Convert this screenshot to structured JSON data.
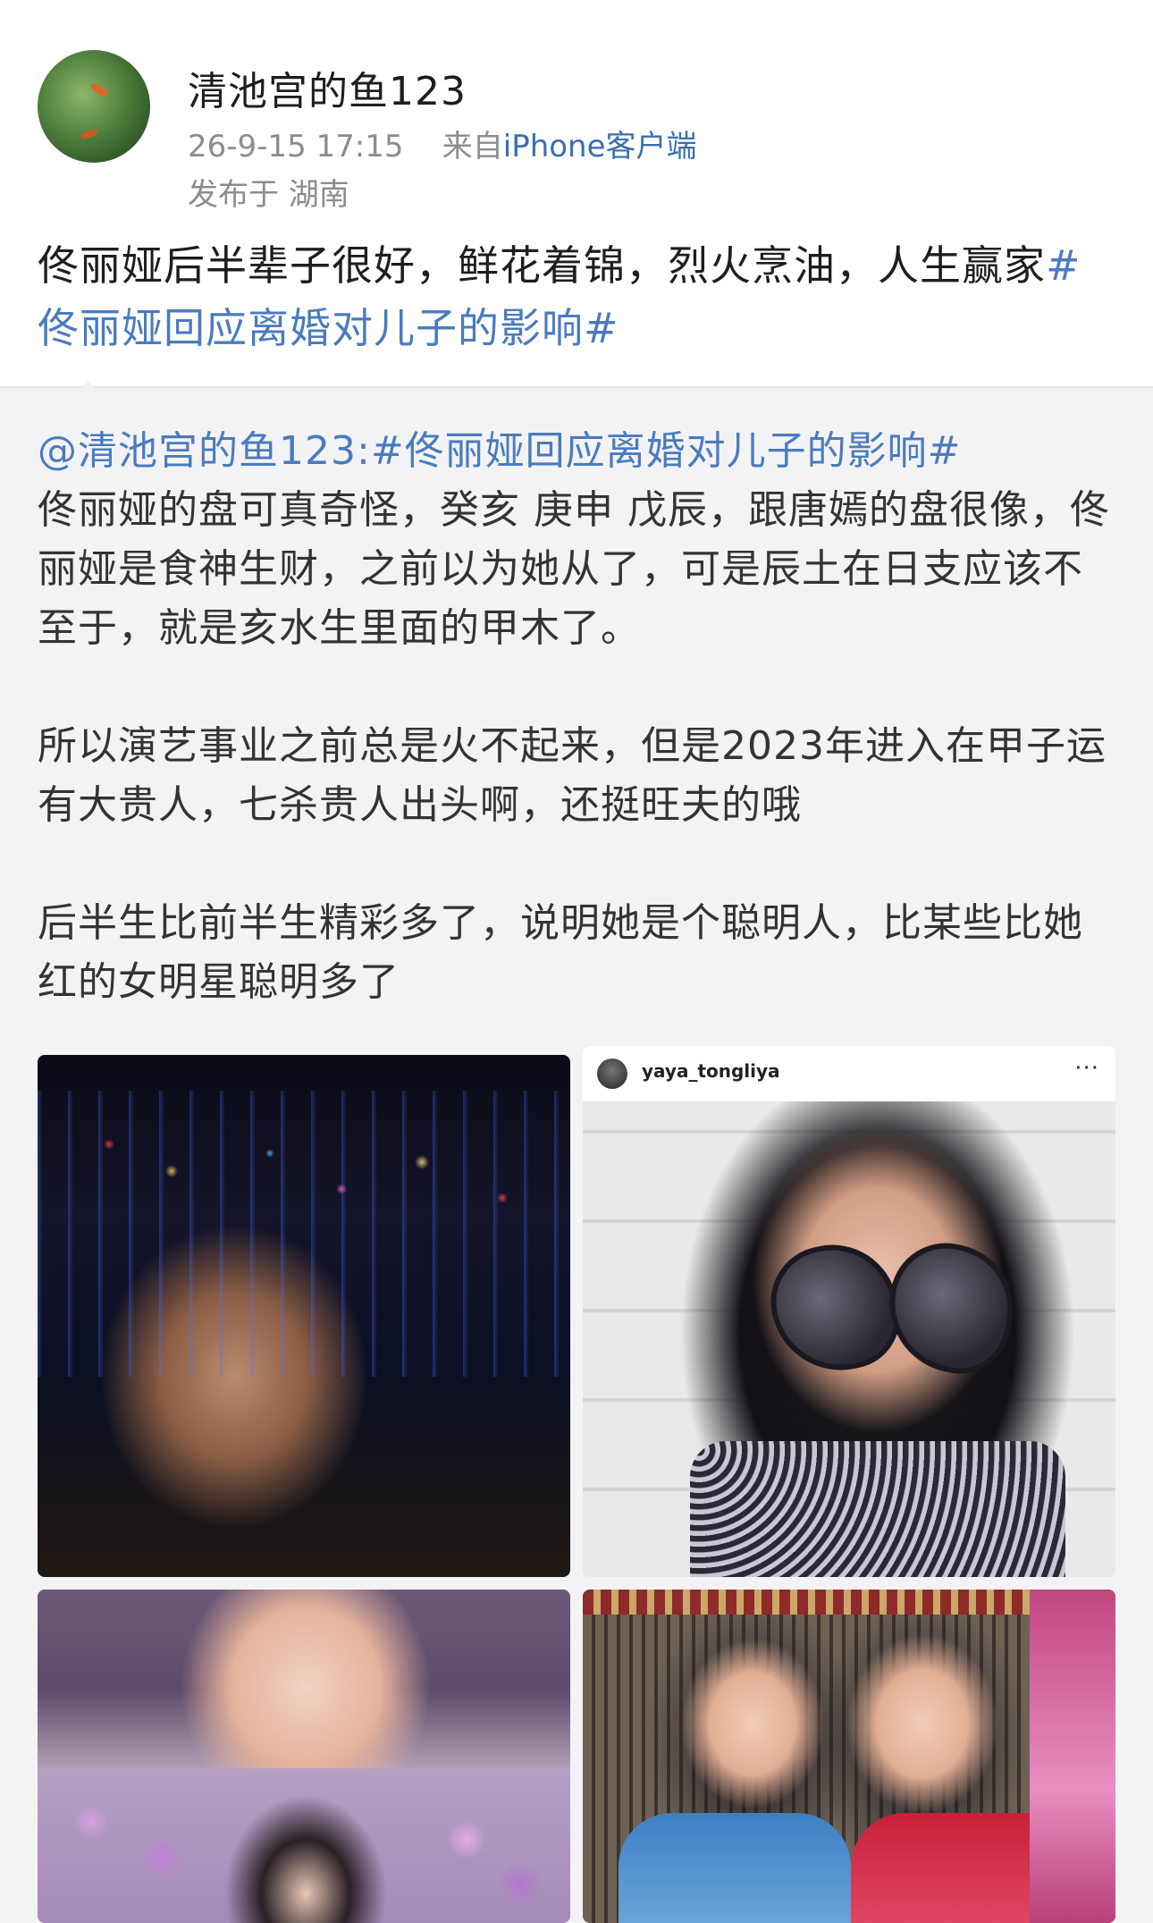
{
  "author": {
    "name": "清池宫的鱼123",
    "time": "26-9-15 17:15",
    "source_prefix": "来自",
    "source_client": "iPhone客户端",
    "location": "发布于 湖南"
  },
  "post": {
    "text": "佟丽娅后半辈子很好，鲜花着锦，烈火烹油，人生赢家",
    "hashtag": "#佟丽娅回应离婚对儿子的影响#"
  },
  "quote": {
    "mention": "@清池宫的鱼123:",
    "hashtag": "#佟丽娅回应离婚对儿子的影响#",
    "paragraph_1": "佟丽娅的盘可真奇怪，癸亥 庚申 戊辰，跟唐嫣的盘很像，佟丽娅是食神生财，之前以为她从了，可是辰土在日支应该不至于，就是亥水生里面的甲木了。",
    "paragraph_2": "所以演艺事业之前总是火不起来，但是2023年进入在甲子运有大贵人，七杀贵人出头啊，还挺旺夫的哦",
    "paragraph_3": "后半生比前半生精彩多了，说明她是个聪明人，比某些比她红的女明星聪明多了"
  },
  "photos": {
    "instagram_username": "yaya_tongliya",
    "instagram_more": "···"
  },
  "colors": {
    "link": "#4a7bbf",
    "meta": "#8c8c8c",
    "quote_background": "#f3f3f5"
  }
}
